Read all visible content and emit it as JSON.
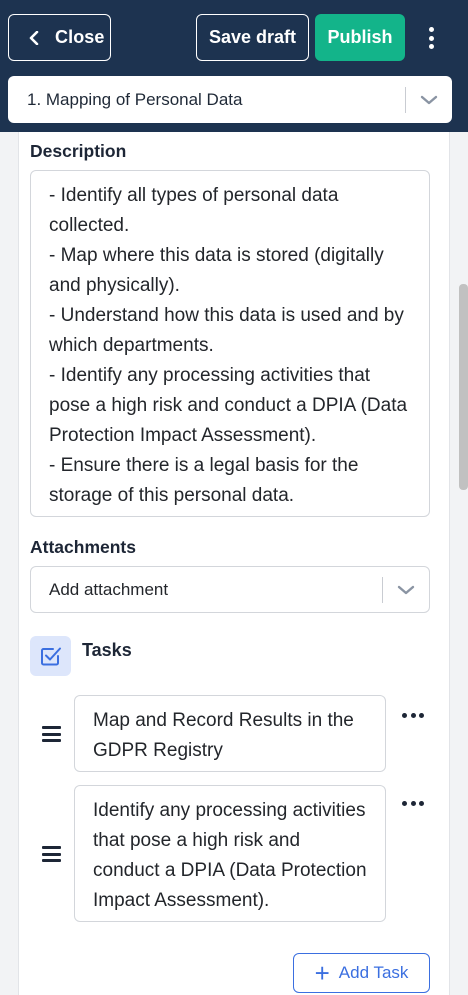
{
  "header": {
    "close_label": "Close",
    "save_draft_label": "Save draft",
    "publish_label": "Publish",
    "section_selected": "1. Mapping of Personal Data"
  },
  "description": {
    "label": "Description",
    "lines": [
      "- Identify all types of personal data",
      "collected.",
      "- Map where this data is stored (digitally",
      "and physically).",
      "- Understand how this data is used and by",
      "which departments.",
      "- Identify any processing activities that",
      "pose a high risk and conduct a DPIA (Data",
      "Protection Impact Assessment).",
      "- Ensure there is a legal basis for the",
      "storage of this personal data."
    ]
  },
  "attachments": {
    "label": "Attachments",
    "placeholder": "Add attachment"
  },
  "tasks": {
    "title": "Tasks",
    "items": [
      {
        "lines": [
          "Map and Record Results in the",
          "GDPR Registry"
        ]
      },
      {
        "lines": [
          "Identify any processing activities",
          "that pose a high risk and",
          "conduct a DPIA (Data Protection",
          "Impact Assessment)."
        ]
      }
    ],
    "add_label": "Add Task"
  },
  "colors": {
    "header_bg": "#1d3350",
    "publish_green": "#13b48a",
    "accent_blue": "#3b6fe0"
  }
}
